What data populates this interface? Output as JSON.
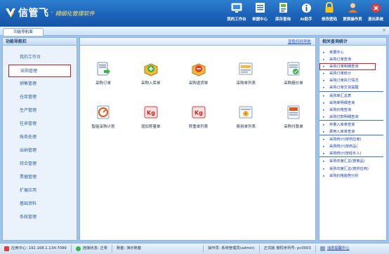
{
  "header": {
    "brand": "信管飞",
    "tagline": "精细化管理软件",
    "nav": [
      {
        "label": "我的工作台",
        "icon": "monitor-icon"
      },
      {
        "label": "单据中心",
        "icon": "document-list-icon"
      },
      {
        "label": "库存查询",
        "icon": "inventory-query-icon"
      },
      {
        "label": "AI助手",
        "icon": "info-icon"
      },
      {
        "label": "修改密码",
        "icon": "lock-icon"
      },
      {
        "label": "更换操作员",
        "icon": "user-icon"
      },
      {
        "label": "退出系统",
        "icon": "exit-icon"
      }
    ]
  },
  "tabs": [
    {
      "label": "功能导航面"
    }
  ],
  "sidebar": {
    "title": "功能导航栏",
    "items": [
      {
        "label": "我的工作台"
      },
      {
        "label": "采购管理",
        "active": true
      },
      {
        "label": "销售管理"
      },
      {
        "label": "仓库管理"
      },
      {
        "label": "生产管理"
      },
      {
        "label": "往来管理"
      },
      {
        "label": "账务处理"
      },
      {
        "label": "出纳管理"
      },
      {
        "label": "综合管理"
      },
      {
        "label": "票据管理"
      },
      {
        "label": "扩展应用"
      },
      {
        "label": "基础资料"
      },
      {
        "label": "系统管理"
      }
    ]
  },
  "main": {
    "hide_link": "显隐扫码导航",
    "tiles_row1": [
      {
        "label": "采购订单",
        "icon": "purchase-order-icon"
      },
      {
        "label": "采购入库单",
        "icon": "purchase-inbound-icon"
      },
      {
        "label": "采购退货单",
        "icon": "purchase-return-icon"
      },
      {
        "label": "采购单列表",
        "icon": "purchase-list-icon"
      },
      {
        "label": "采购报价单",
        "icon": "purchase-quote-icon"
      }
    ],
    "tiles_row2": [
      {
        "label": "智能采购计划",
        "icon": "smart-plan-icon"
      },
      {
        "label": "增加称量单",
        "icon": "weigh-add-icon"
      },
      {
        "label": "称重单列表",
        "icon": "weigh-list-icon"
      },
      {
        "label": "费用单列表",
        "icon": "expense-list-icon"
      },
      {
        "label": "采购付款单",
        "icon": "payment-icon"
      }
    ]
  },
  "related": {
    "title": "相关查询统计",
    "items": [
      {
        "label": "单据中心"
      },
      {
        "label": "采购订单查询"
      },
      {
        "label": "采购订单明细查询",
        "highlight": true
      },
      {
        "label": "采购订单统计"
      },
      {
        "label": "采购订单执行情况"
      },
      {
        "label": "采购订单交货提醒",
        "sep": true
      },
      {
        "label": "采购单汇总表"
      },
      {
        "label": "采购单明细查询"
      },
      {
        "label": "采购价格查询"
      },
      {
        "label": "采购付款明细查询",
        "sep": true
      },
      {
        "label": "存量入库单查询"
      },
      {
        "label": "费用入库单查询",
        "sep": true
      },
      {
        "label": "采购统计(按供应商)"
      },
      {
        "label": "采购统计(按商品)"
      },
      {
        "label": "采购统计(按经手人)",
        "sep": true
      },
      {
        "label": "采购年度汇总(按商品)"
      },
      {
        "label": "采购年度汇总(按供应商)"
      },
      {
        "label": "采购价格趋势分析"
      }
    ]
  },
  "status": {
    "server": "应用中心: 192.168.1.134:7099",
    "connection": "连接状态: 正常",
    "account": "账套: 演示账套",
    "operator": "操作员: 系统管理员(admin)",
    "license": "正式版 授权序列号: pc0003",
    "message": "消息提醒中心"
  },
  "colors": {
    "header": "#1c63b8",
    "highlight_border": "#d02020",
    "link": "#1a3fa8"
  }
}
